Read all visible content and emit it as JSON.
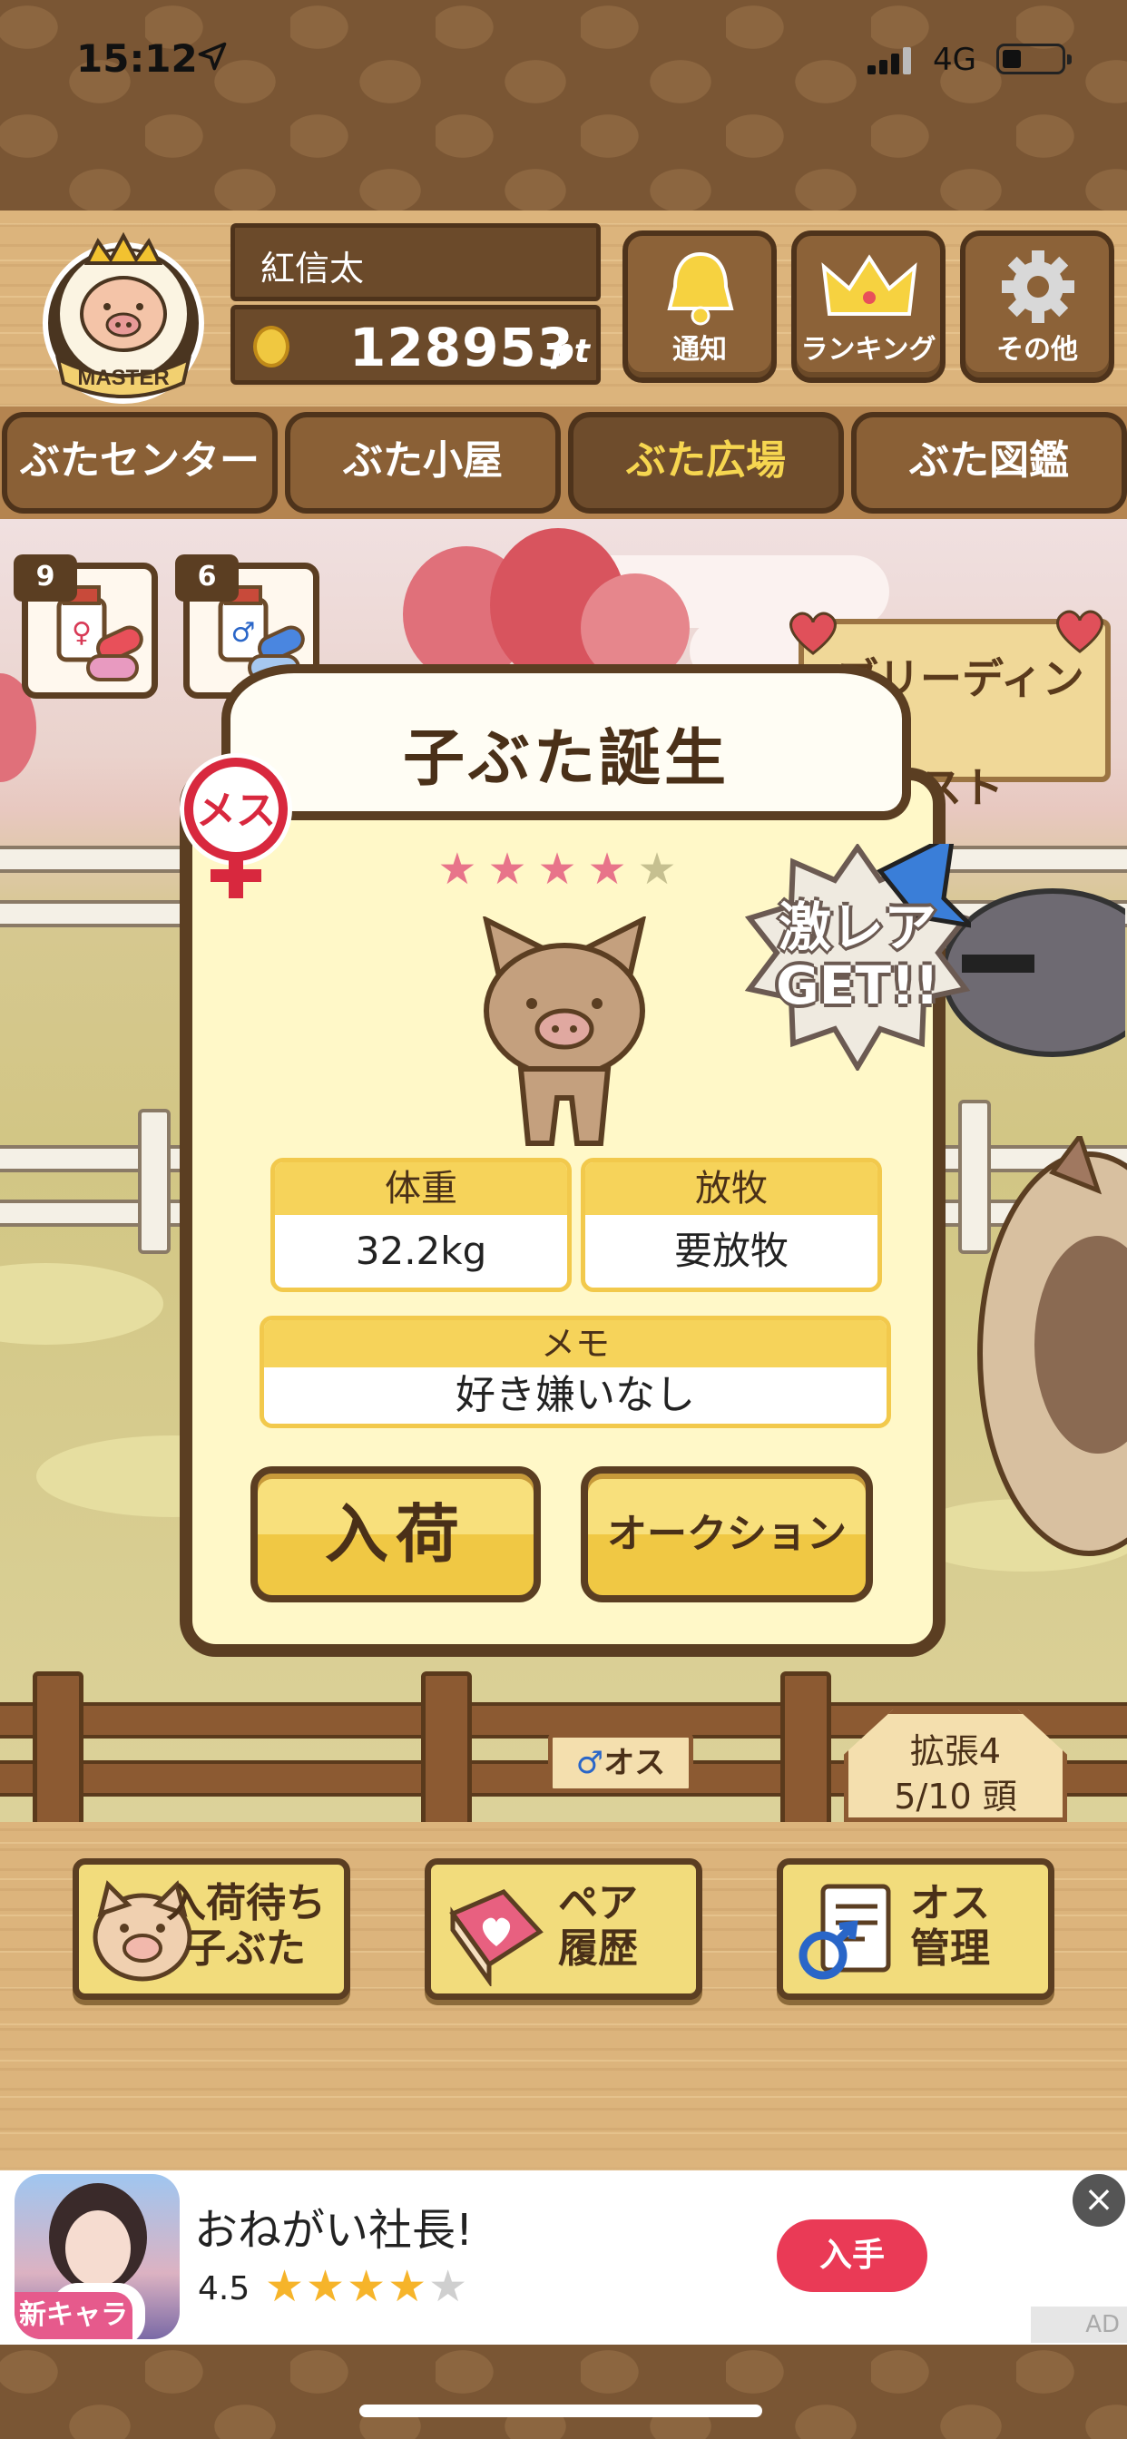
{
  "status_bar": {
    "time": "15:12",
    "network": "4G"
  },
  "header": {
    "badge_label": "MASTER",
    "user_name": "紅信太",
    "points": "128953",
    "points_unit": "pt",
    "buttons": {
      "notice": "通知",
      "ranking": "ランキング",
      "other": "その他"
    }
  },
  "tabs": [
    "ぶたセンター",
    "ぶた小屋",
    "ぶた広場",
    "ぶた図鑑"
  ],
  "active_tab": "ぶた広場",
  "scene": {
    "female_item_count": "9",
    "male_item_count": "6",
    "quest_sign": [
      "ブリーディング",
      "クエスト"
    ],
    "male_sign": "オス",
    "expand_sign_line1": "拡張4",
    "expand_sign_line2": "5/10 頭"
  },
  "modal": {
    "title": "子ぶた誕生",
    "gender_badge": "メス",
    "rarity": {
      "filled": 4,
      "total": 5
    },
    "rare_banner_line1": "激レア",
    "rare_banner_line2": "GET!!",
    "weight_label": "体重",
    "weight_value": "32.2kg",
    "grazing_label": "放牧",
    "grazing_value": "要放牧",
    "memo_label": "メモ",
    "memo_value": "好き嫌いなし",
    "stock_button": "入荷",
    "auction_button": "オークション"
  },
  "bottom_buttons": {
    "waiting": [
      "入荷待ち",
      "子ぶた"
    ],
    "pair": [
      "ペア",
      "履歴"
    ],
    "male": [
      "オス",
      "管理"
    ]
  },
  "ad": {
    "title": "おねがい社長!",
    "rating": "4.5",
    "stars_filled": 4.5,
    "cta": "入手",
    "icon_tag": "新キャラ",
    "label": "AD",
    "close": "×"
  },
  "colors": {
    "wood": "#dcb47c",
    "dark_brown": "#5b3e22",
    "modal_bg": "#fff8c8",
    "yellow_label": "#f6d35a",
    "ad_cta": "#ea3a56",
    "active_tab_text": "#f6d650"
  }
}
